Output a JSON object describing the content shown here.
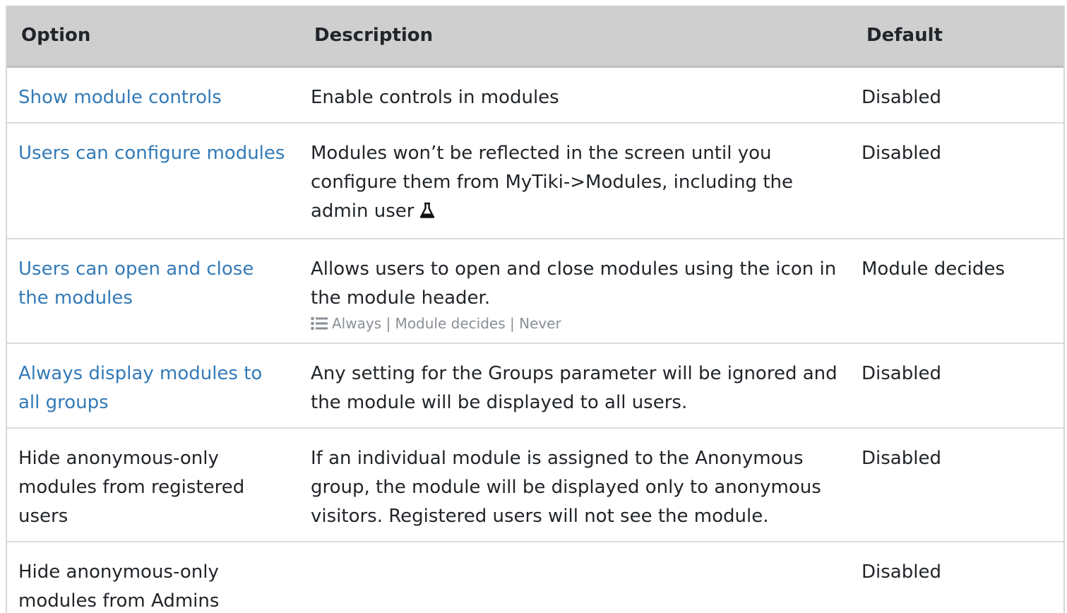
{
  "headers": {
    "option": "Option",
    "description": "Description",
    "default": "Default"
  },
  "rows": [
    {
      "option": "Show module controls",
      "link": true,
      "description": "Enable controls in modules",
      "default": "Disabled"
    },
    {
      "option": "Users can configure modules",
      "link": true,
      "description": "Modules won’t be reflected in the screen until you configure them from MyTiki->Modules, including the admin user",
      "experimental_icon": "flask-icon",
      "default": "Disabled"
    },
    {
      "option": "Users can open and close the modules",
      "link": true,
      "description": "Allows users to open and close modules using the icon in the module header.",
      "options_icon": "list-icon",
      "options": "Always | Module decides | Never",
      "default": "Module decides"
    },
    {
      "option": "Always display modules to all groups",
      "link": true,
      "description": "Any setting for the Groups parameter will be ignored and the module will be displayed to all users.",
      "default": "Disabled"
    },
    {
      "option": "Hide anonymous-only modules from registered users",
      "link": false,
      "description": "If an individual module is assigned to the Anonymous group, the module will be displayed only to anonymous visitors. Registered users will not see the module.",
      "default": "Disabled"
    },
    {
      "option": "Hide anonymous-only modules from Admins",
      "link": false,
      "description": "",
      "default": "Disabled"
    }
  ],
  "colors": {
    "link": "#337ab7",
    "header_bg": "#cfcfcf",
    "muted": "#8a8f94"
  }
}
